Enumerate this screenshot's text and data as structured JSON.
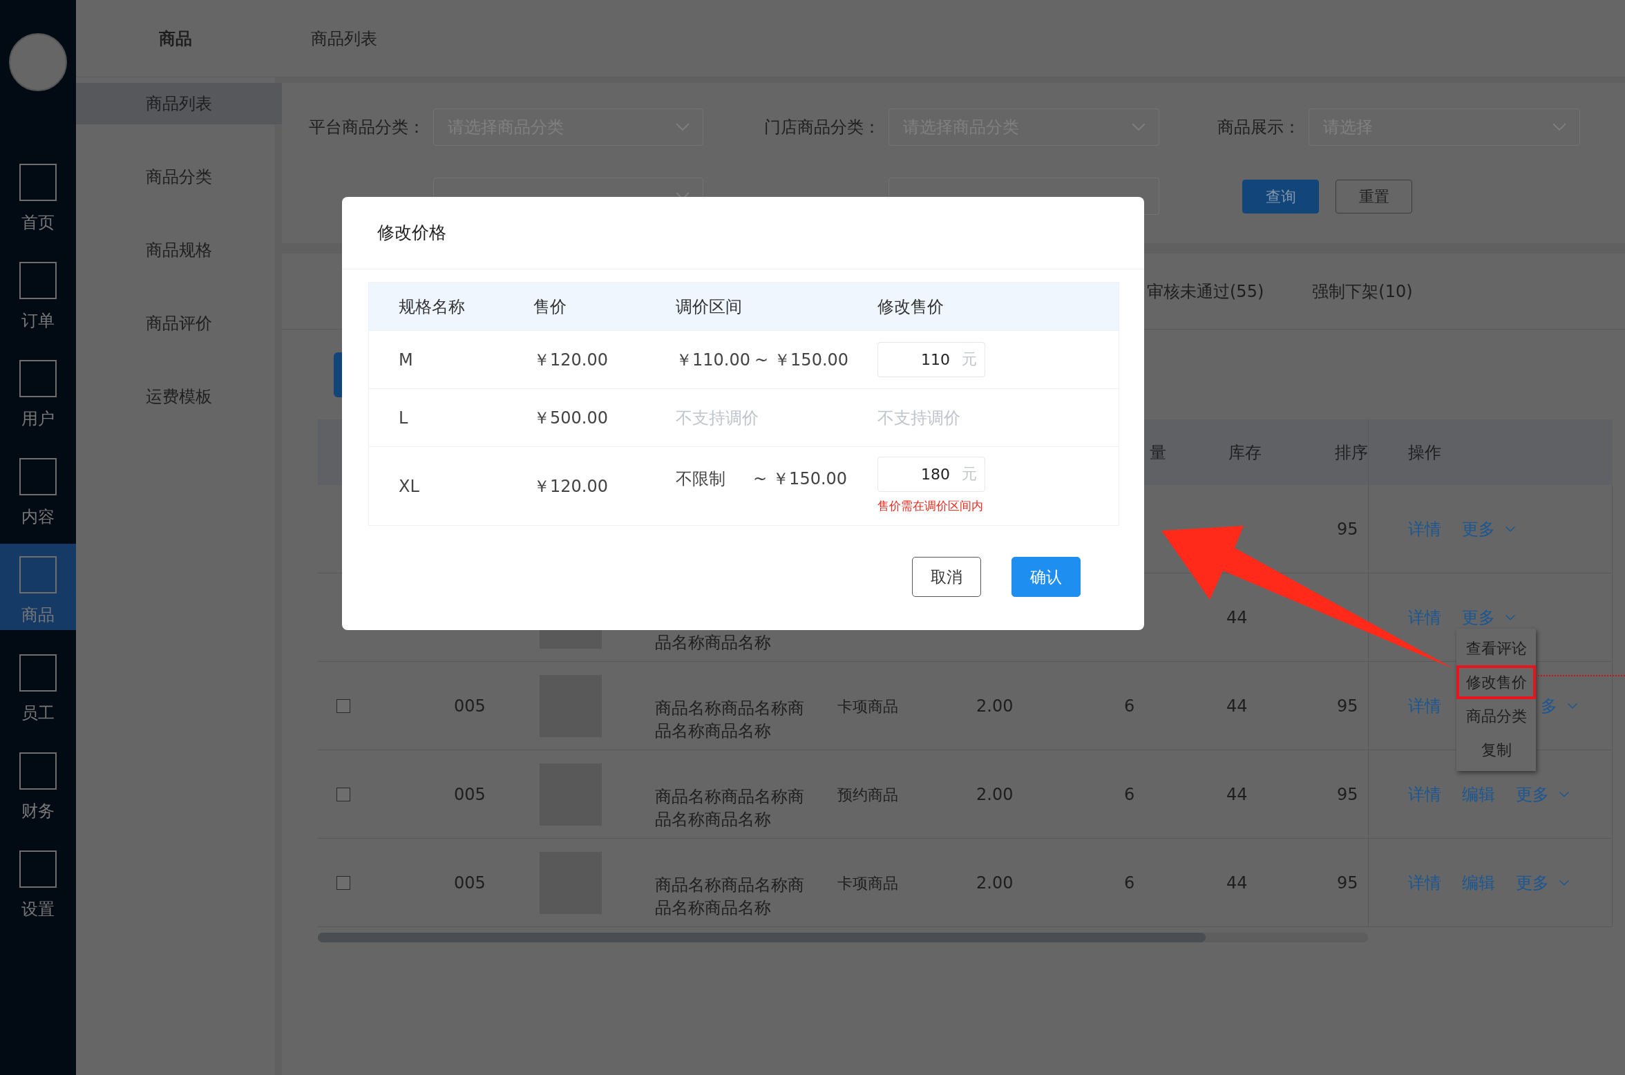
{
  "nav": [
    {
      "label": "首页",
      "selected": false
    },
    {
      "label": "订单",
      "selected": false
    },
    {
      "label": "用户",
      "selected": false
    },
    {
      "label": "内容",
      "selected": false
    },
    {
      "label": "商品",
      "selected": true
    },
    {
      "label": "员工",
      "selected": false
    },
    {
      "label": "财务",
      "selected": false
    },
    {
      "label": "设置",
      "selected": false
    }
  ],
  "sidebar": {
    "title": "商品",
    "items": [
      {
        "label": "商品列表",
        "selected": true
      },
      {
        "label": "商品分类",
        "selected": false
      },
      {
        "label": "商品规格",
        "selected": false
      },
      {
        "label": "商品评价",
        "selected": false
      },
      {
        "label": "运费模板",
        "selected": false
      }
    ]
  },
  "breadcrumb": "商品列表",
  "filters": [
    {
      "label": "平台商品分类：",
      "placeholder": "请选择商品分类"
    },
    {
      "label": "门店商品分类：",
      "placeholder": "请选择商品分类"
    },
    {
      "label": "商品展示：",
      "placeholder": "请选择"
    }
  ],
  "filters_row_2": [
    {
      "kind": "select"
    },
    {
      "kind": "input"
    }
  ],
  "filter_buttons": [
    {
      "label": "查询",
      "kind": "primary"
    },
    {
      "label": "重置",
      "kind": "default"
    }
  ],
  "tabs": [
    {
      "label": "审核未通过(55)",
      "selected": false
    },
    {
      "label": "强制下架(10)",
      "selected": false
    }
  ],
  "table": {
    "header": {
      "sales": "量",
      "stock": "库存",
      "sort": "排序",
      "actions": "操作"
    },
    "rows": [
      {
        "image": false,
        "sort": "95",
        "actions": [
          {
            "kind": "link",
            "label": "详情"
          },
          {
            "kind": "more",
            "label": "更多"
          }
        ]
      },
      {
        "image": true,
        "name": {
          "line_2": "品名称商品名称"
        },
        "stock": "44",
        "actions": [
          {
            "kind": "link",
            "label": "详情"
          },
          {
            "kind": "more",
            "label": "更多"
          }
        ]
      },
      {
        "checked": false,
        "image": true,
        "id": "005",
        "name": {
          "line_1": "商品名称商品名称商",
          "line_2": "品名称商品名称"
        },
        "type": "卡项商品",
        "price": "2.00",
        "sales": "6",
        "stock": "44",
        "sort": "95",
        "actions": [
          {
            "kind": "link",
            "label": "详情"
          },
          {
            "kind": "covered"
          },
          {
            "kind": "more",
            "label": "多"
          }
        ]
      },
      {
        "checked": false,
        "image": true,
        "id": "005",
        "name": {
          "line_1": "商品名称商品名称商",
          "line_2": "品名称商品名称"
        },
        "type": "预约商品",
        "price": "2.00",
        "sales": "6",
        "stock": "44",
        "sort": "95",
        "actions": [
          {
            "kind": "link",
            "label": "详情"
          },
          {
            "kind": "link",
            "label": "编辑"
          },
          {
            "kind": "more",
            "label": "更多"
          }
        ]
      },
      {
        "checked": false,
        "image": true,
        "id": "005",
        "name": {
          "line_1": "商品名称商品名称商",
          "line_2": "品名称商品名称"
        },
        "type": "卡项商品",
        "price": "2.00",
        "sales": "6",
        "stock": "44",
        "sort": "95",
        "actions": [
          {
            "kind": "link",
            "label": "详情"
          },
          {
            "kind": "link",
            "label": "编辑"
          },
          {
            "kind": "more",
            "label": "更多"
          }
        ]
      }
    ]
  },
  "more_menu": {
    "items": [
      {
        "label": "查看评论",
        "highlighted": false
      },
      {
        "label": "修改售价",
        "highlighted": true
      },
      {
        "label": "商品分类",
        "highlighted": false
      },
      {
        "label": "复制",
        "highlighted": false
      }
    ]
  },
  "dialog": {
    "title": "修改价格",
    "columns": [
      "规格名称",
      "售价",
      "调价区间",
      "修改售价"
    ],
    "rows": [
      {
        "spec": "M",
        "price": "￥120.00",
        "adjustable": true,
        "range_min": "￥110.00",
        "range_separator": "~",
        "range_max": "￥150.00",
        "new_price": "110",
        "unit": "元"
      },
      {
        "spec": "L",
        "price": "￥500.00",
        "adjustable": false,
        "range_note": "不支持调价",
        "price_note": "不支持调价"
      },
      {
        "spec": "XL",
        "price": "￥120.00",
        "adjustable": true,
        "range_min": "不限制",
        "range_separator": "~",
        "range_max": "￥150.00",
        "new_price": "180",
        "unit": "元",
        "error": "售价需在调价区间内"
      }
    ],
    "buttons": [
      {
        "label": "取消",
        "kind": "default"
      },
      {
        "label": "确认",
        "kind": "primary"
      }
    ]
  }
}
